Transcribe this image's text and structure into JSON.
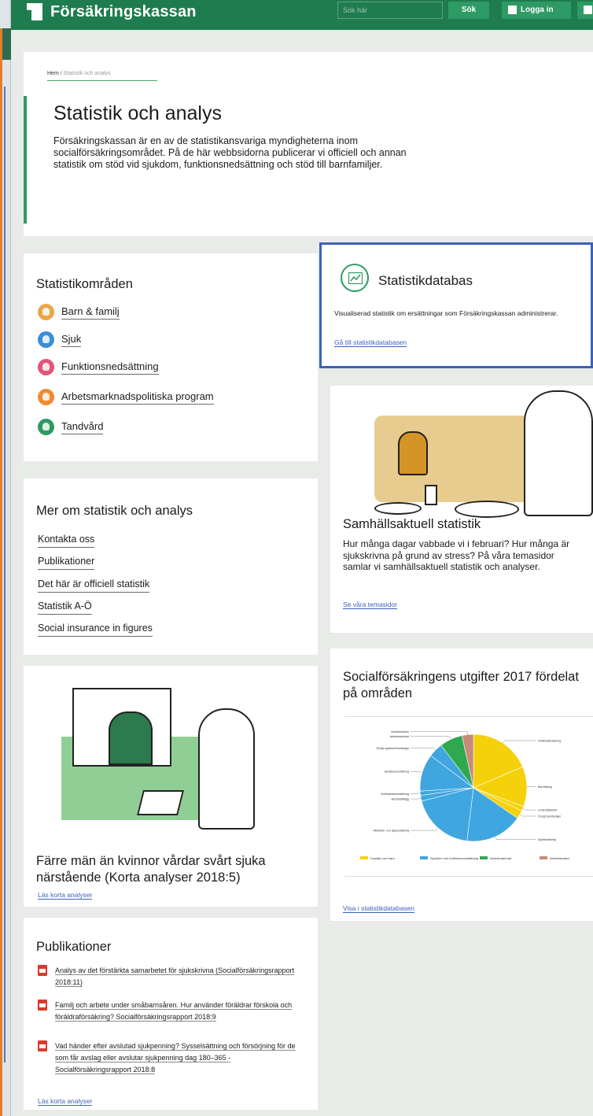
{
  "header": {
    "brand": "Försäkringskassan",
    "search_placeholder": "Sök här",
    "search_button": "Sök",
    "login_button": "Logga in"
  },
  "hero": {
    "breadcrumb_home": "Hem",
    "breadcrumb_sep": " / ",
    "breadcrumb_current": "Statistik och analys",
    "title": "Statistik och analys",
    "intro": "Försäkringskassan är en av de statistikansvariga myndigheterna inom socialförsäkringsområdet. På de här webbsidorna publicerar vi officiell och annan statistik om stöd vid sjukdom, funktionsnedsättning och stöd till barnfamiljer."
  },
  "areas": {
    "title": "Statistikområden",
    "items": [
      {
        "label": "Barn & familj",
        "icon": "family-icon",
        "color": "#e8a84a"
      },
      {
        "label": "Sjuk",
        "icon": "sick-icon",
        "color": "#3a8fd6"
      },
      {
        "label": "Funktionsnedsättning",
        "icon": "disability-icon",
        "color": "#e0557a"
      },
      {
        "label": "Arbetsmarknadspolitiska program",
        "icon": "labour-market-icon",
        "color": "#ef8a2f"
      },
      {
        "label": "Tandvård",
        "icon": "tooth-icon",
        "color": "#2d9b63"
      }
    ]
  },
  "database": {
    "title": "Statistikdatabas",
    "icon": "line-chart-icon",
    "description": "Visualiserad statistik om ersättningar som Försäkringskassan administrerar.",
    "link": "Gå till statistikdatabasen"
  },
  "more": {
    "title": "Mer om statistik och analys",
    "links": [
      "Kontakta oss",
      "Publikationer",
      "Det här är officiell statistik",
      "Statistik A-Ö",
      "Social insurance in figures"
    ]
  },
  "society": {
    "title": "Samhällsaktuell statistik",
    "text": "Hur många dagar vabbade vi i februari?  Hur många är sjukskrivna på grund av stress? På våra temasidor samlar vi samhällsaktuell statistik och analyser.",
    "link": "Se våra temasidor"
  },
  "care": {
    "title": "Färre män än kvinnor vårdar svårt sjuka närstående (Korta analyser 2018:5)",
    "link": "Läs korta analyser"
  },
  "costs": {
    "title": "Socialförsäkringens utgifter 2017 fördelat på områden",
    "link": "Visa i statistikdatabasen"
  },
  "chart_data": {
    "type": "pie",
    "title": "",
    "slice_colors": {
      "Familjer och barn": "#f5d10b",
      "Sjukdom och funktionsnedsättning": "#3fa6df",
      "Arbetsmarknad": "#2fa84f",
      "Administration": "#c98a7a"
    },
    "legend": [
      "Familjer och barn",
      "Sjukdom och funktionsnedsättning",
      "Arbetsmarknad",
      "Administration"
    ],
    "slices": [
      {
        "label": "Föräldraförsäkring",
        "value": 43,
        "group": "Familjer och barn"
      },
      {
        "label": "Barnbidrag",
        "value": 28,
        "group": "Familjer och barn"
      },
      {
        "label": "Underhållsstöd",
        "value": 3,
        "group": "Familjer och barn"
      },
      {
        "label": "Övrigt barnfamiljer",
        "value": 6,
        "group": "Familjer och barn"
      },
      {
        "label": "Sjukförsäkring",
        "value": 40,
        "group": "Sjukdom och funktionsnedsättning"
      },
      {
        "label": "Aktivitets- och sjukersättning",
        "value": 44,
        "group": "Sjukdom och funktionsnedsättning"
      },
      {
        "label": "Bostadstillägg",
        "value": 4,
        "group": "Sjukdom och funktionsnedsättning"
      },
      {
        "label": "Arbetsskadeersättning",
        "value": 3,
        "group": "Sjukdom och funktionsnedsättning"
      },
      {
        "label": "Assistansersättning",
        "value": 26,
        "group": "Sjukdom och funktionsnedsättning"
      },
      {
        "label": "Övrigt sjukdom/handikapp",
        "value": 10,
        "group": "Sjukdom och funktionsnedsättning"
      },
      {
        "label": "Arbetsmarknad",
        "value": 16,
        "group": "Arbetsmarknad"
      },
      {
        "label": "Administration",
        "value": 8,
        "group": "Administration"
      }
    ]
  },
  "publications": {
    "title": "Publikationer",
    "items": [
      "Analys av det förstärkta samarbetet för sjukskrivna (Socialförsäkringsrapport 2018:11)",
      "Familj och arbete under småbarnsåren. Hur använder föräldrar förskola och föräldraförsäkring? Socialförsäkringsrapport 2018:9",
      "Vad händer efter avslutad sjukpenning? Sysselsättning och försörjning för de som får avslag eller avslutar sjukpenning dag 180–365 - Socialförsäkringsrapport 2018:8"
    ],
    "link": "Läs korta analyser"
  }
}
